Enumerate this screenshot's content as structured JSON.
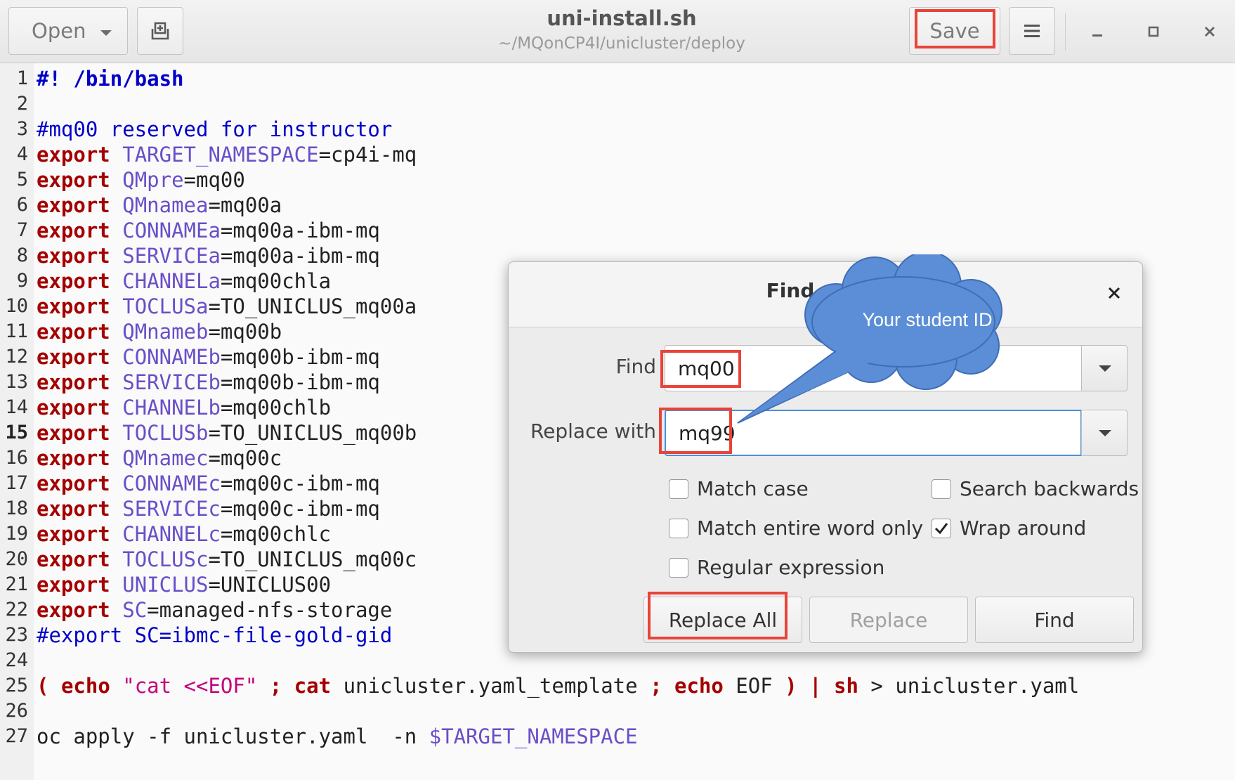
{
  "window": {
    "title": "uni-install.sh",
    "path": "~/MQonCP4I/unicluster/deploy"
  },
  "toolbar": {
    "open_label": "Open",
    "save_label": "Save"
  },
  "editor": {
    "current_line": 15,
    "lines": [
      {
        "n": "1",
        "tokens": [
          {
            "c": "shebang",
            "t": "#! /bin/bash"
          }
        ]
      },
      {
        "n": "2",
        "tokens": []
      },
      {
        "n": "3",
        "tokens": [
          {
            "c": "com",
            "t": "#mq00 reserved for instructor"
          }
        ]
      },
      {
        "n": "4",
        "tokens": [
          {
            "c": "kw",
            "t": "export"
          },
          {
            "c": "txt",
            "t": " "
          },
          {
            "c": "var",
            "t": "TARGET_NAMESPACE"
          },
          {
            "c": "txt",
            "t": "=cp4i-mq"
          }
        ]
      },
      {
        "n": "5",
        "tokens": [
          {
            "c": "kw",
            "t": "export"
          },
          {
            "c": "txt",
            "t": " "
          },
          {
            "c": "var",
            "t": "QMpre"
          },
          {
            "c": "txt",
            "t": "=mq00"
          }
        ]
      },
      {
        "n": "6",
        "tokens": [
          {
            "c": "kw",
            "t": "export"
          },
          {
            "c": "txt",
            "t": " "
          },
          {
            "c": "var",
            "t": "QMnamea"
          },
          {
            "c": "txt",
            "t": "=mq00a"
          }
        ]
      },
      {
        "n": "7",
        "tokens": [
          {
            "c": "kw",
            "t": "export"
          },
          {
            "c": "txt",
            "t": " "
          },
          {
            "c": "var",
            "t": "CONNAMEa"
          },
          {
            "c": "txt",
            "t": "=mq00a-ibm-mq"
          }
        ]
      },
      {
        "n": "8",
        "tokens": [
          {
            "c": "kw",
            "t": "export"
          },
          {
            "c": "txt",
            "t": " "
          },
          {
            "c": "var",
            "t": "SERVICEa"
          },
          {
            "c": "txt",
            "t": "=mq00a-ibm-mq"
          }
        ]
      },
      {
        "n": "9",
        "tokens": [
          {
            "c": "kw",
            "t": "export"
          },
          {
            "c": "txt",
            "t": " "
          },
          {
            "c": "var",
            "t": "CHANNELa"
          },
          {
            "c": "txt",
            "t": "=mq00chla"
          }
        ]
      },
      {
        "n": "10",
        "tokens": [
          {
            "c": "kw",
            "t": "export"
          },
          {
            "c": "txt",
            "t": " "
          },
          {
            "c": "var",
            "t": "TOCLUSa"
          },
          {
            "c": "txt",
            "t": "=TO_UNICLUS_mq00a"
          }
        ]
      },
      {
        "n": "11",
        "tokens": [
          {
            "c": "kw",
            "t": "export"
          },
          {
            "c": "txt",
            "t": " "
          },
          {
            "c": "var",
            "t": "QMnameb"
          },
          {
            "c": "txt",
            "t": "=mq00b"
          }
        ]
      },
      {
        "n": "12",
        "tokens": [
          {
            "c": "kw",
            "t": "export"
          },
          {
            "c": "txt",
            "t": " "
          },
          {
            "c": "var",
            "t": "CONNAMEb"
          },
          {
            "c": "txt",
            "t": "=mq00b-ibm-mq"
          }
        ]
      },
      {
        "n": "13",
        "tokens": [
          {
            "c": "kw",
            "t": "export"
          },
          {
            "c": "txt",
            "t": " "
          },
          {
            "c": "var",
            "t": "SERVICEb"
          },
          {
            "c": "txt",
            "t": "=mq00b-ibm-mq"
          }
        ]
      },
      {
        "n": "14",
        "tokens": [
          {
            "c": "kw",
            "t": "export"
          },
          {
            "c": "txt",
            "t": " "
          },
          {
            "c": "var",
            "t": "CHANNELb"
          },
          {
            "c": "txt",
            "t": "=mq00chlb"
          }
        ]
      },
      {
        "n": "15",
        "tokens": [
          {
            "c": "kw",
            "t": "export"
          },
          {
            "c": "txt",
            "t": " "
          },
          {
            "c": "var",
            "t": "TOCLUSb"
          },
          {
            "c": "txt",
            "t": "=TO_UNICLUS_mq00b"
          }
        ]
      },
      {
        "n": "16",
        "tokens": [
          {
            "c": "kw",
            "t": "export"
          },
          {
            "c": "txt",
            "t": " "
          },
          {
            "c": "var",
            "t": "QMnamec"
          },
          {
            "c": "txt",
            "t": "=mq00c"
          }
        ]
      },
      {
        "n": "17",
        "tokens": [
          {
            "c": "kw",
            "t": "export"
          },
          {
            "c": "txt",
            "t": " "
          },
          {
            "c": "var",
            "t": "CONNAMEc"
          },
          {
            "c": "txt",
            "t": "=mq00c-ibm-mq"
          }
        ]
      },
      {
        "n": "18",
        "tokens": [
          {
            "c": "kw",
            "t": "export"
          },
          {
            "c": "txt",
            "t": " "
          },
          {
            "c": "var",
            "t": "SERVICEc"
          },
          {
            "c": "txt",
            "t": "=mq00c-ibm-mq"
          }
        ]
      },
      {
        "n": "19",
        "tokens": [
          {
            "c": "kw",
            "t": "export"
          },
          {
            "c": "txt",
            "t": " "
          },
          {
            "c": "var",
            "t": "CHANNELc"
          },
          {
            "c": "txt",
            "t": "=mq00chlc"
          }
        ]
      },
      {
        "n": "20",
        "tokens": [
          {
            "c": "kw",
            "t": "export"
          },
          {
            "c": "txt",
            "t": " "
          },
          {
            "c": "var",
            "t": "TOCLUSc"
          },
          {
            "c": "txt",
            "t": "=TO_UNICLUS_mq00c"
          }
        ]
      },
      {
        "n": "21",
        "tokens": [
          {
            "c": "kw",
            "t": "export"
          },
          {
            "c": "txt",
            "t": " "
          },
          {
            "c": "var",
            "t": "UNICLUS"
          },
          {
            "c": "txt",
            "t": "=UNICLUS00"
          }
        ]
      },
      {
        "n": "22",
        "tokens": [
          {
            "c": "kw",
            "t": "export"
          },
          {
            "c": "txt",
            "t": " "
          },
          {
            "c": "var",
            "t": "SC"
          },
          {
            "c": "txt",
            "t": "=managed-nfs-storage"
          }
        ]
      },
      {
        "n": "23",
        "tokens": [
          {
            "c": "com",
            "t": "#export SC=ibmc-file-gold-gid"
          }
        ]
      },
      {
        "n": "24",
        "tokens": []
      },
      {
        "n": "25",
        "tokens": [
          {
            "c": "kw",
            "t": "("
          },
          {
            "c": "txt",
            "t": " "
          },
          {
            "c": "kw",
            "t": "echo"
          },
          {
            "c": "txt",
            "t": " "
          },
          {
            "c": "str",
            "t": "\"cat <<EOF\""
          },
          {
            "c": "txt",
            "t": " "
          },
          {
            "c": "kw",
            "t": ";"
          },
          {
            "c": "txt",
            "t": " "
          },
          {
            "c": "kw",
            "t": "cat"
          },
          {
            "c": "txt",
            "t": " unicluster.yaml_template "
          },
          {
            "c": "kw",
            "t": ";"
          },
          {
            "c": "txt",
            "t": " "
          },
          {
            "c": "kw",
            "t": "echo"
          },
          {
            "c": "txt",
            "t": " EOF "
          },
          {
            "c": "kw",
            "t": ")"
          },
          {
            "c": "txt",
            "t": " "
          },
          {
            "c": "kw",
            "t": "|"
          },
          {
            "c": "txt",
            "t": " "
          },
          {
            "c": "kw",
            "t": "sh"
          },
          {
            "c": "txt",
            "t": " > unicluster.yaml"
          }
        ]
      },
      {
        "n": "26",
        "tokens": []
      },
      {
        "n": "27",
        "tokens": [
          {
            "c": "txt",
            "t": "oc apply -f unicluster.yaml  -n "
          },
          {
            "c": "var",
            "t": "$TARGET_NAMESPACE"
          }
        ]
      }
    ]
  },
  "dialog": {
    "title": "Find and R",
    "find_label": "Find",
    "find_value": "mq00",
    "replace_label": "Replace with",
    "replace_value": "mq99",
    "options": {
      "match_case": {
        "label": "Match case",
        "checked": false
      },
      "match_entire_word": {
        "label": "Match entire word only",
        "checked": false
      },
      "regular_expression": {
        "label": "Regular expression",
        "checked": false
      },
      "search_backwards": {
        "label": "Search backwards",
        "checked": false
      },
      "wrap_around": {
        "label": "Wrap around",
        "checked": true
      }
    },
    "buttons": {
      "replace_all": "Replace All",
      "replace": "Replace",
      "find": "Find"
    }
  },
  "callout": {
    "text": "Your student ID",
    "color": "#5b8ed6"
  },
  "colors": {
    "highlight": "#e8443a",
    "focus": "#4a90d9"
  }
}
